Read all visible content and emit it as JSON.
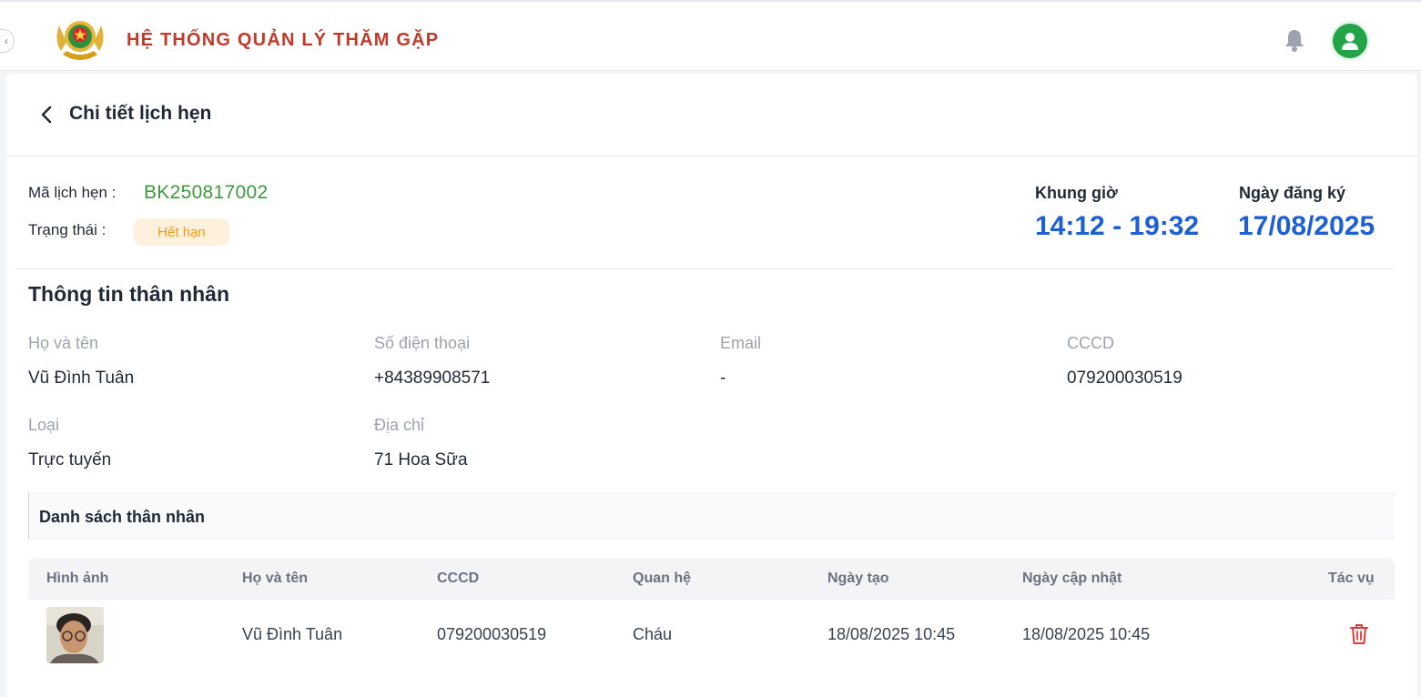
{
  "header": {
    "title": "HỆ THỐNG QUẢN LÝ THĂM GẶP",
    "brand_color": "#c0392b",
    "avatar_color": "#22a447",
    "icons": [
      "emblem-logo",
      "bell-icon",
      "user-icon"
    ]
  },
  "page": {
    "title": "Chi tiết lịch hẹn"
  },
  "booking": {
    "code_label": "Mã lịch hẹn :",
    "code": "BK250817002",
    "status_label": "Trạng thái :",
    "status": "Hết hạn",
    "slot_label": "Khung giờ",
    "slot": "14:12 - 19:32",
    "reg_date_label": "Ngày đăng ký",
    "reg_date": "17/08/2025"
  },
  "relative_info": {
    "title": "Thông tin thân nhân",
    "fields": [
      {
        "label": "Họ và tên",
        "value": "Vũ Đình Tuân"
      },
      {
        "label": "Số điện thoại",
        "value": "+84389908571"
      },
      {
        "label": "Email",
        "value": "-"
      },
      {
        "label": "CCCD",
        "value": "079200030519"
      },
      {
        "label": "Loại",
        "value": "Trực tuyến"
      },
      {
        "label": "Địa chỉ",
        "value": "71 Hoa Sữa"
      }
    ]
  },
  "relatives_list": {
    "title": "Danh sách thân nhân",
    "columns": [
      "Hình ảnh",
      "Họ và tên",
      "CCCD",
      "Quan hệ",
      "Ngày tạo",
      "Ngày cập nhật",
      "Tác vụ"
    ],
    "rows": [
      {
        "name": "Vũ Đình Tuân",
        "id": "079200030519",
        "relation": "Cháu",
        "created": "18/08/2025 10:45",
        "updated": "18/08/2025 10:45"
      }
    ]
  }
}
